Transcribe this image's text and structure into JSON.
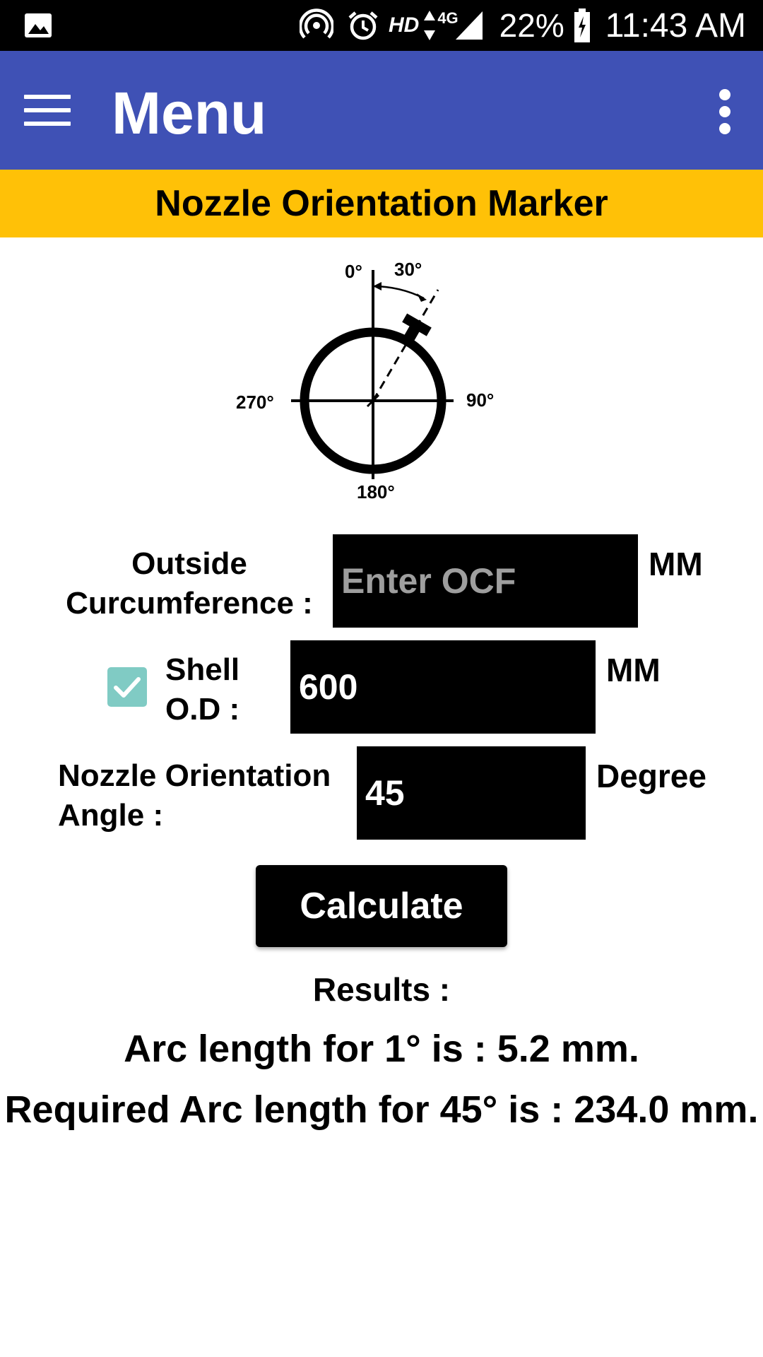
{
  "status_bar": {
    "battery": "22%",
    "time": "11:43 AM",
    "hd": "HD",
    "network": "4G",
    "icons": [
      "gallery-icon",
      "hotspot-icon",
      "alarm-icon",
      "data-arrows-icon",
      "signal-icon",
      "battery-charging-icon"
    ]
  },
  "app_bar": {
    "title": "Menu",
    "color": "#3f51b5",
    "menu_icon": "hamburger-icon",
    "more_icon": "overflow-menu-icon"
  },
  "banner": {
    "title": "Nozzle Orientation Marker",
    "color": "#ffc107"
  },
  "diagram": {
    "labels": {
      "top": "0°",
      "angle": "30°",
      "right": "90°",
      "bottom": "180°",
      "left": "270°"
    }
  },
  "form": {
    "ocf": {
      "label_line1": "Outside",
      "label_line2": "Curcumference :",
      "placeholder": "Enter OCF",
      "value": "",
      "unit": "MM"
    },
    "shell": {
      "checked": true,
      "label_line1": "Shell",
      "label_line2": "O.D :",
      "value": "600",
      "unit": "MM"
    },
    "angle": {
      "label_line1": "Nozzle Orientation",
      "label_line2": "Angle :",
      "value": "45",
      "unit": "Degree"
    },
    "calculate_label": "Calculate"
  },
  "results": {
    "title": "Results :",
    "line1": "Arc length for 1° is : 5.2 mm.",
    "line2": "Required Arc length for 45° is : 234.0 mm."
  }
}
